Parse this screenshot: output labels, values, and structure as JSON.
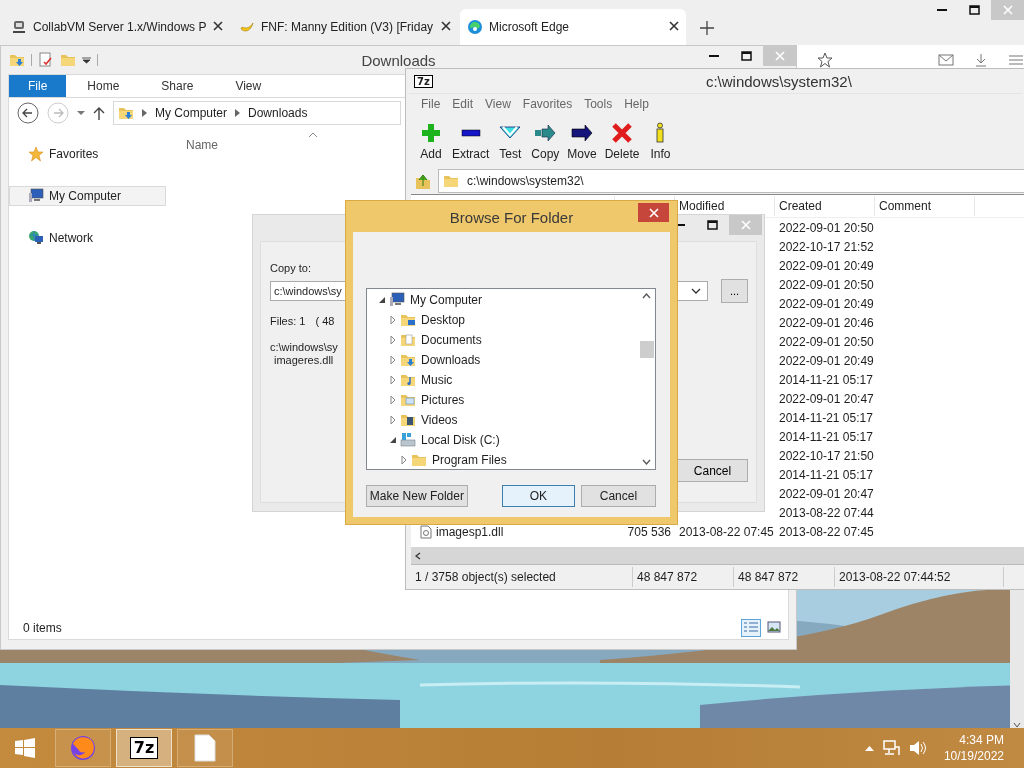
{
  "browser": {
    "tabs": [
      {
        "label": "CollabVM Server 1.x/Windows P",
        "kind": "server",
        "selected": false
      },
      {
        "label": "FNF: Manny Edition (V3) [Friday",
        "kind": "banana",
        "selected": false
      },
      {
        "label": "Microsoft Edge",
        "kind": "swirl",
        "selected": true
      }
    ]
  },
  "explorer": {
    "title": "Downloads",
    "ribbon_tabs": [
      {
        "label": "File",
        "selected": true
      },
      {
        "label": "Home",
        "selected": false
      },
      {
        "label": "Share",
        "selected": false
      },
      {
        "label": "View",
        "selected": false
      }
    ],
    "path": [
      "My Computer",
      "Downloads"
    ],
    "nav": [
      {
        "label": "Favorites",
        "kind": "favorites",
        "selected": false
      },
      {
        "label": "My Computer",
        "kind": "computer",
        "selected": true
      },
      {
        "label": "Network",
        "kind": "network",
        "selected": false
      }
    ],
    "column": "Name",
    "status": "0 items"
  },
  "archiver": {
    "logo": "7z",
    "title": "c:\\windows\\system32\\",
    "menu": [
      "File",
      "Edit",
      "View",
      "Favorites",
      "Tools",
      "Help"
    ],
    "tools": [
      {
        "label": "Add",
        "kind": "add"
      },
      {
        "label": "Extract",
        "kind": "extract"
      },
      {
        "label": "Test",
        "kind": "test"
      },
      {
        "label": "Copy",
        "kind": "copy"
      },
      {
        "label": "Move",
        "kind": "move"
      },
      {
        "label": "Delete",
        "kind": "delete"
      },
      {
        "label": "Info",
        "kind": "info"
      }
    ],
    "path": "c:\\windows\\system32\\",
    "columns": {
      "modified": "Modified",
      "created": "Created",
      "comment": "Comment"
    },
    "rows": [
      {
        "created": "2022-09-01 20:50"
      },
      {
        "created": "2022-10-17 21:52"
      },
      {
        "created": "2022-09-01 20:49"
      },
      {
        "created": "2022-09-01 20:50"
      },
      {
        "created": "2022-09-01 20:49"
      },
      {
        "created": "2022-09-01 20:46"
      },
      {
        "created": "2022-09-01 20:50"
      },
      {
        "created": "2022-09-01 20:49"
      },
      {
        "created": "2014-11-21 05:17"
      },
      {
        "created": "2022-09-01 20:47"
      },
      {
        "created": "2014-11-21 05:17"
      },
      {
        "created": "2014-11-21 05:17"
      },
      {
        "created": "2022-10-17 21:50"
      },
      {
        "created": "2014-11-21 05:17"
      },
      {
        "created": "2022-09-01 20:47"
      },
      {
        "created": "2013-08-22 07:44"
      },
      {
        "name": "imagesp1.dll",
        "size": "705 536",
        "modified": "2013-08-22 07:45",
        "created": "2013-08-22 07:45"
      }
    ],
    "status": [
      "1 / 3758 object(s) selected",
      "48 847 872",
      "48 847 872",
      "2013-08-22 07:44:52"
    ]
  },
  "copy_dialog": {
    "label": "Copy to:",
    "path": "c:\\windows\\sy",
    "files": "Files: 1",
    "size": "( 48",
    "source_path": "c:\\windows\\sy",
    "file": "imageres.dll",
    "browse": "...",
    "cancel": "Cancel"
  },
  "browse_dialog": {
    "title": "Browse For Folder",
    "tree": [
      {
        "label": "My Computer",
        "kind": "computer",
        "expanded": true,
        "children": [
          {
            "label": "Desktop",
            "kind": "desktop",
            "expanded": false
          },
          {
            "label": "Documents",
            "kind": "documents",
            "expanded": false
          },
          {
            "label": "Downloads",
            "kind": "downloads",
            "expanded": false
          },
          {
            "label": "Music",
            "kind": "music",
            "expanded": false
          },
          {
            "label": "Pictures",
            "kind": "pictures",
            "expanded": false
          },
          {
            "label": "Videos",
            "kind": "videos",
            "expanded": false
          },
          {
            "label": "Local Disk (C:)",
            "kind": "disk",
            "expanded": true,
            "children": [
              {
                "label": "Program Files",
                "kind": "folder",
                "expanded": false
              }
            ]
          }
        ]
      }
    ],
    "buttons": [
      {
        "label": "Make New Folder",
        "default": false
      },
      {
        "label": "OK",
        "default": true
      },
      {
        "label": "Cancel",
        "default": false
      }
    ]
  },
  "taskbar": {
    "apps": [
      {
        "kind": "firefox",
        "selected": false
      },
      {
        "kind": "archiver",
        "label": "7z",
        "selected": true
      },
      {
        "kind": "file",
        "selected": false
      }
    ],
    "time": "4:34 PM",
    "date": "10/19/2022"
  }
}
